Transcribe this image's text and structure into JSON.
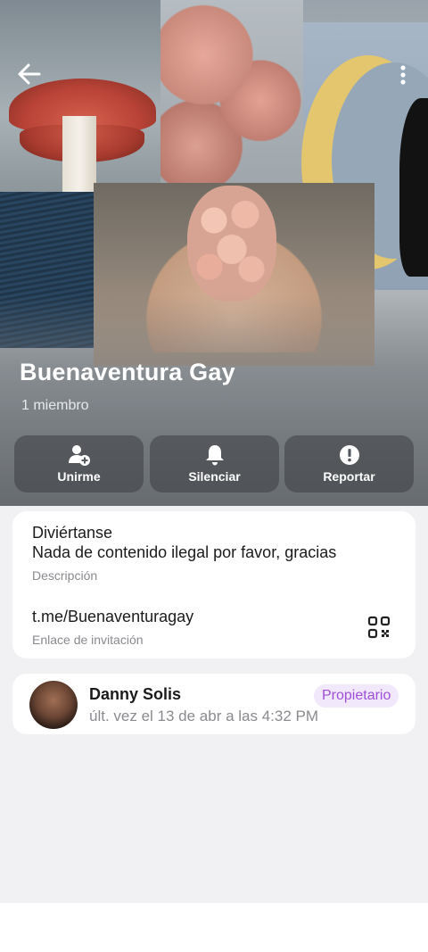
{
  "header": {
    "group_name": "Buenaventura Gay",
    "member_count": "1 miembro",
    "actions": [
      {
        "label": "Unirme",
        "icon": "add-user-icon"
      },
      {
        "label": "Silenciar",
        "icon": "bell-icon"
      },
      {
        "label": "Reportar",
        "icon": "alert-icon"
      }
    ]
  },
  "info": {
    "description_lines": [
      "Diviértanse",
      "Nada de contenido ilegal por favor, gracias"
    ],
    "description_caption": "Descripción",
    "invite_link": "t.me/Buenaventuragay",
    "invite_caption": "Enlace de invitación"
  },
  "member": {
    "name": "Danny Solis",
    "status": "últ. vez el 13 de abr a las 4:32 PM",
    "role": "Propietario"
  },
  "colors": {
    "accent_badge_text": "#a04fd8",
    "accent_badge_bg": "#f1e8fb",
    "page_bg": "#f1f1f3"
  }
}
